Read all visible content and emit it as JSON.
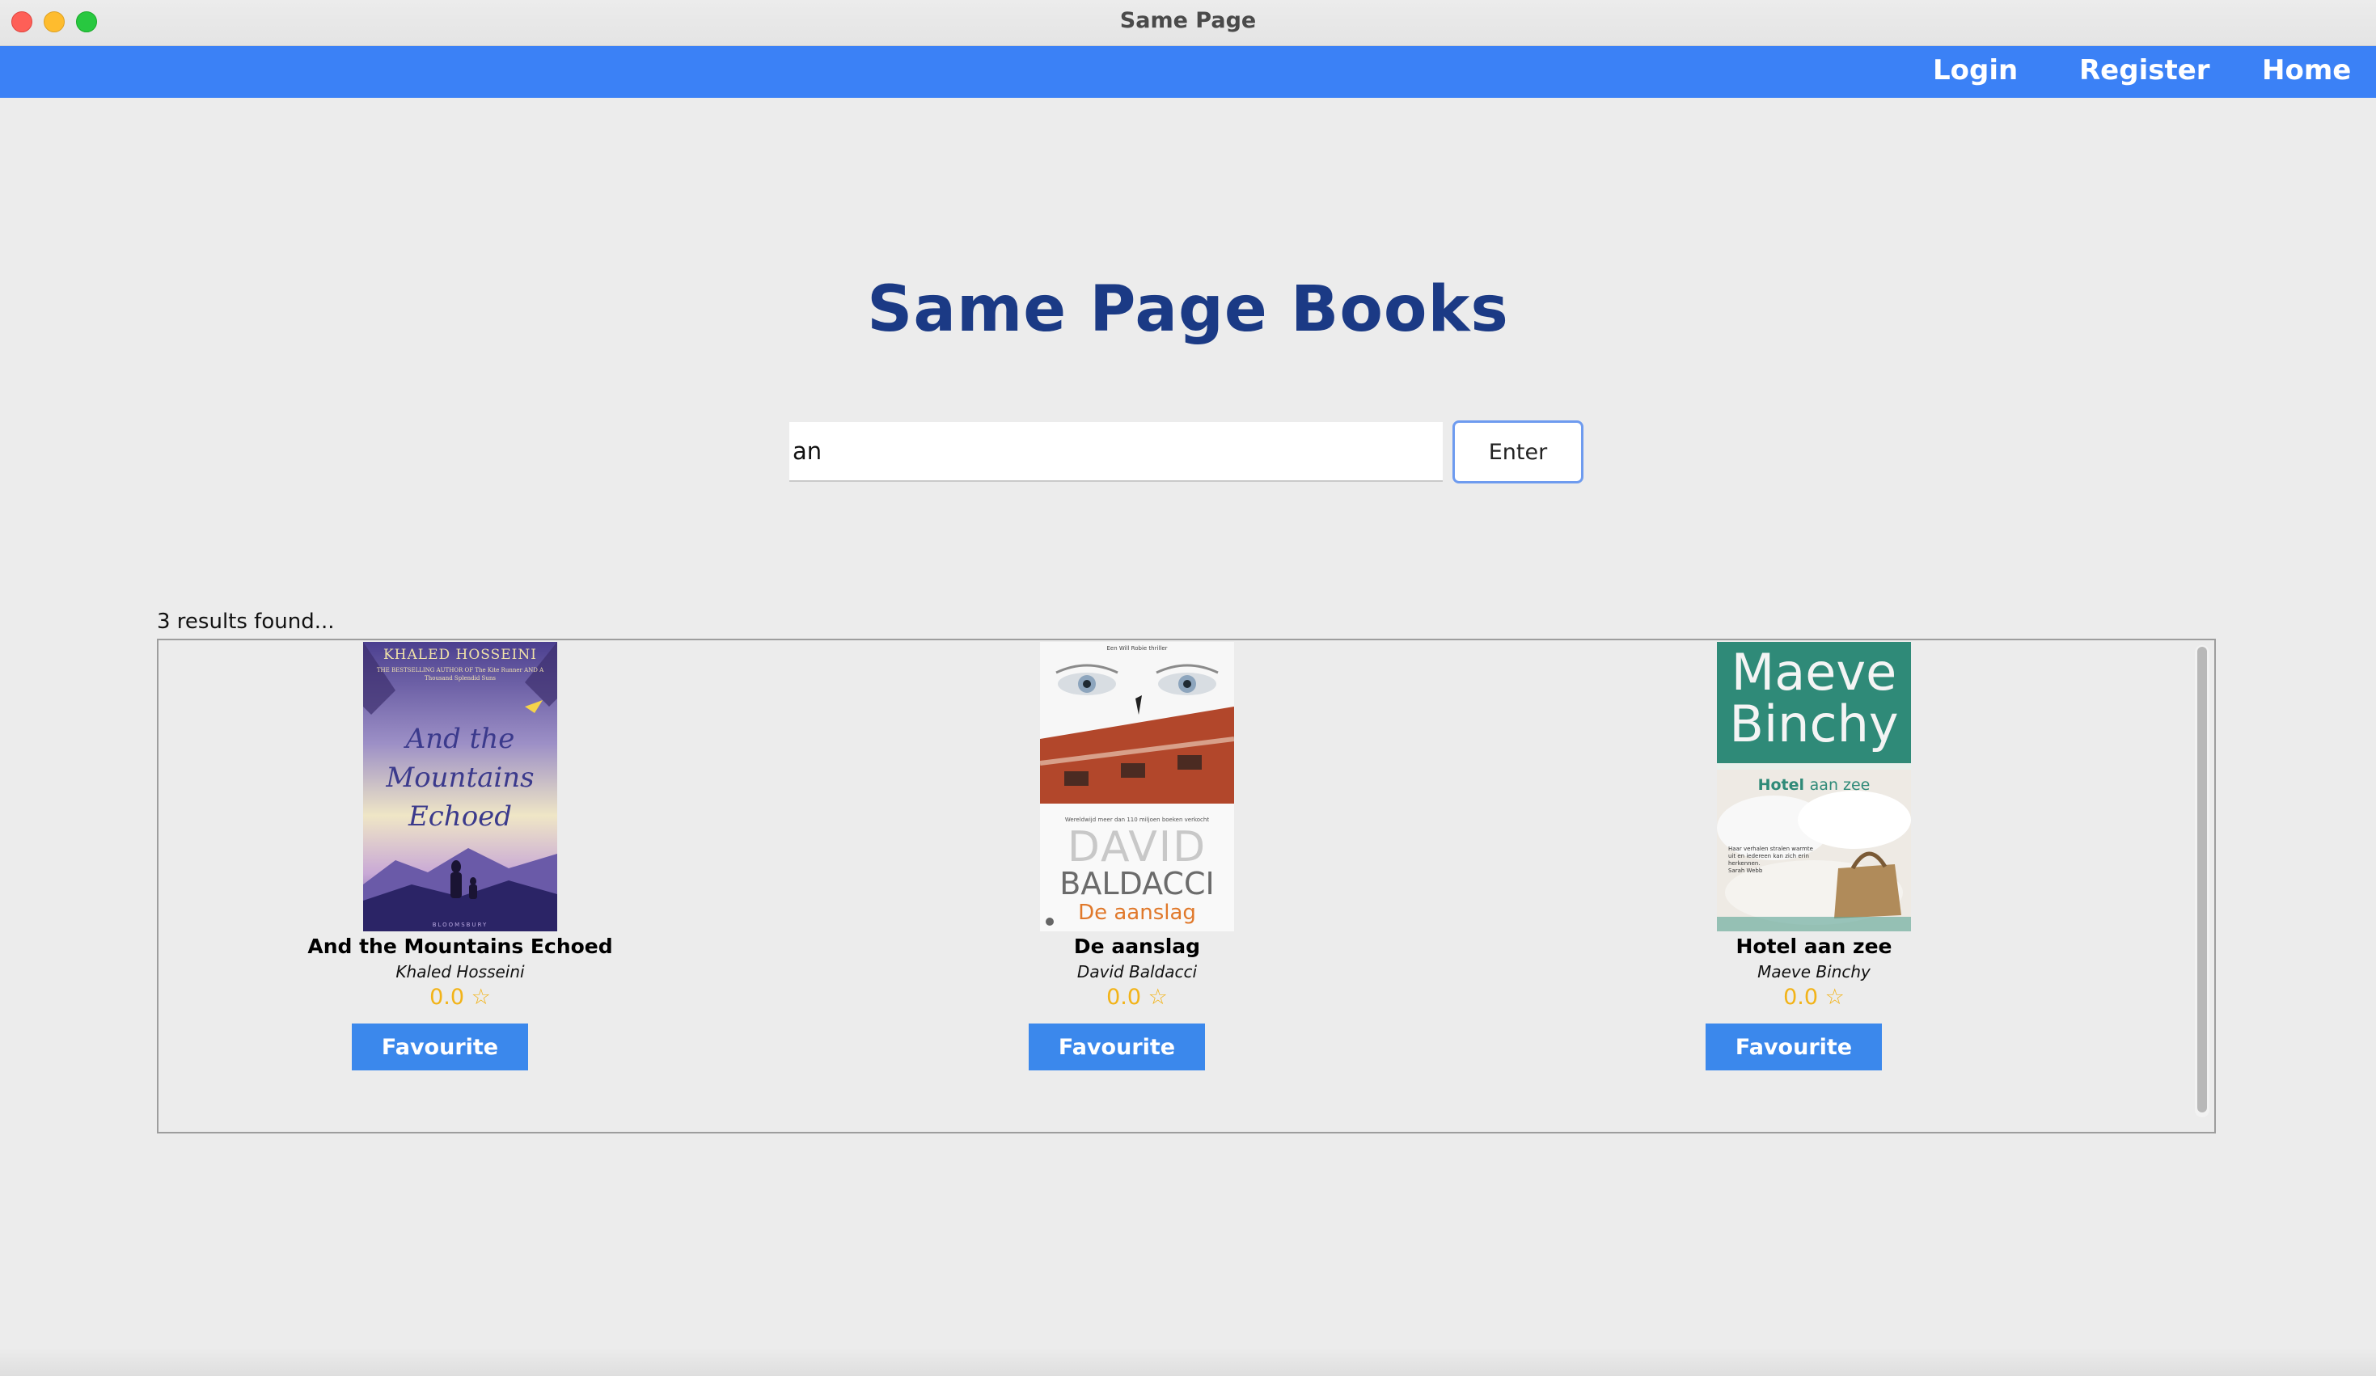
{
  "window": {
    "title": "Same Page"
  },
  "nav": {
    "login": "Login",
    "register": "Register",
    "home": "Home"
  },
  "main": {
    "heading": "Same Page Books"
  },
  "search": {
    "value": "an",
    "button": "Enter"
  },
  "results": {
    "count_text": "3 results found...",
    "books": [
      {
        "title": "And the Mountains Echoed",
        "author": "Khaled Hosseini",
        "rating": "0.0 ☆",
        "favourite_label": "Favourite",
        "cover": {
          "author_text": "KHALED HOSSEINI",
          "tagline": "THE BESTSELLING AUTHOR OF The Kite Runner AND A Thousand Splendid Suns",
          "title_lines": [
            "And the",
            "Mountains",
            "Echoed"
          ],
          "publisher": "BLOOMSBURY"
        }
      },
      {
        "title": "De aanslag",
        "author": "David Baldacci",
        "rating": "0.0 ☆",
        "favourite_label": "Favourite",
        "cover": {
          "top_text": "Een Will Robie thriller",
          "mid_text": "Wereldwijd meer dan 110 miljoen boeken verkocht",
          "author_lines": [
            "DAVID",
            "BALDACCI"
          ],
          "title": "De aanslag"
        }
      },
      {
        "title": "Hotel aan zee",
        "author": "Maeve Binchy",
        "rating": "0.0 ☆",
        "favourite_label": "Favourite",
        "cover": {
          "author_lines": [
            "Maeve",
            "Binchy"
          ],
          "title_prefix": "Hotel ",
          "title_suffix": "aan zee",
          "blurb": "Haar verhalen stralen warmte uit en iedereen kan zich erin herkennen.",
          "blurb_source": "Sarah Webb"
        }
      }
    ]
  },
  "colors": {
    "nav_bar": "#3b81f6",
    "heading": "#1b3a85",
    "favourite_button": "#3b88ec",
    "rating": "#f2b318"
  }
}
